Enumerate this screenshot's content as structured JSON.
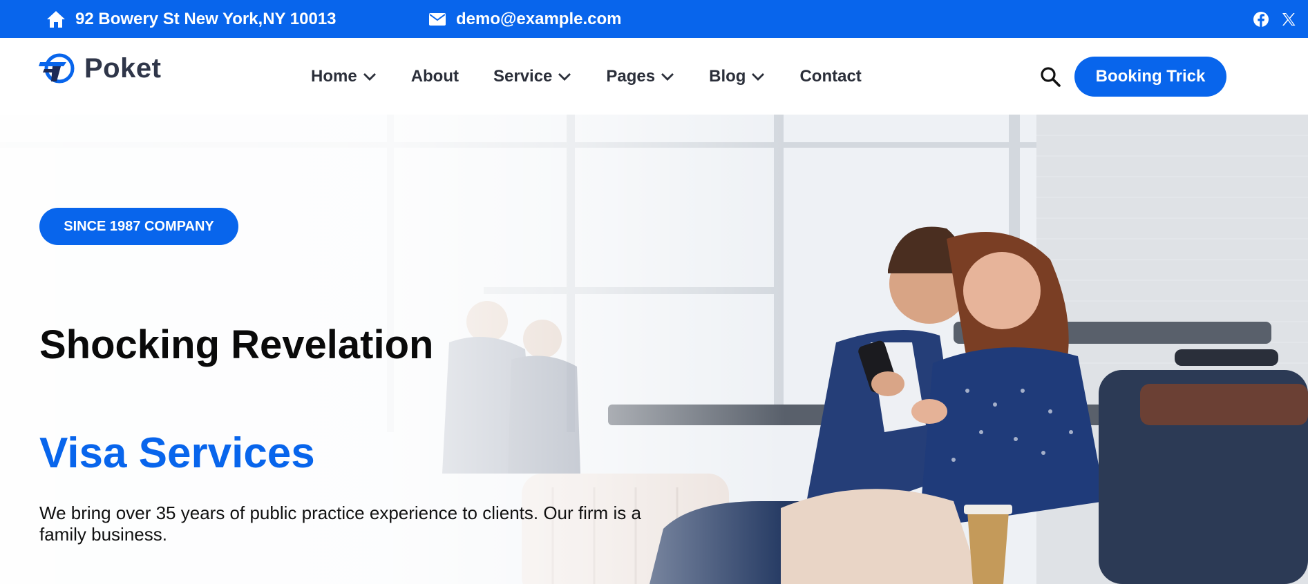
{
  "topbar": {
    "address": "92 Bowery St New York,NY 10013",
    "email": "demo@example.com",
    "icons": {
      "address": "home-icon",
      "email": "envelope-icon",
      "facebook": "facebook-icon",
      "twitter": "x-icon"
    }
  },
  "header": {
    "logo_text": "Poket",
    "nav": [
      {
        "label": "Home",
        "has_dropdown": true
      },
      {
        "label": "About",
        "has_dropdown": false
      },
      {
        "label": "Service",
        "has_dropdown": true
      },
      {
        "label": "Pages",
        "has_dropdown": true
      },
      {
        "label": "Blog",
        "has_dropdown": true
      },
      {
        "label": "Contact",
        "has_dropdown": false
      }
    ],
    "cta_label": "Booking Trick"
  },
  "hero": {
    "badge": "SINCE 1987 COMPANY",
    "headline": "Shocking Revelation",
    "subheadline": "Visa Services",
    "description": "We bring over 35 years of public practice experience to clients. Our firm is a family business."
  },
  "colors": {
    "brand_blue": "#0865ec",
    "nav_text": "#2b2f3a",
    "headline": "#0a0a0a"
  }
}
